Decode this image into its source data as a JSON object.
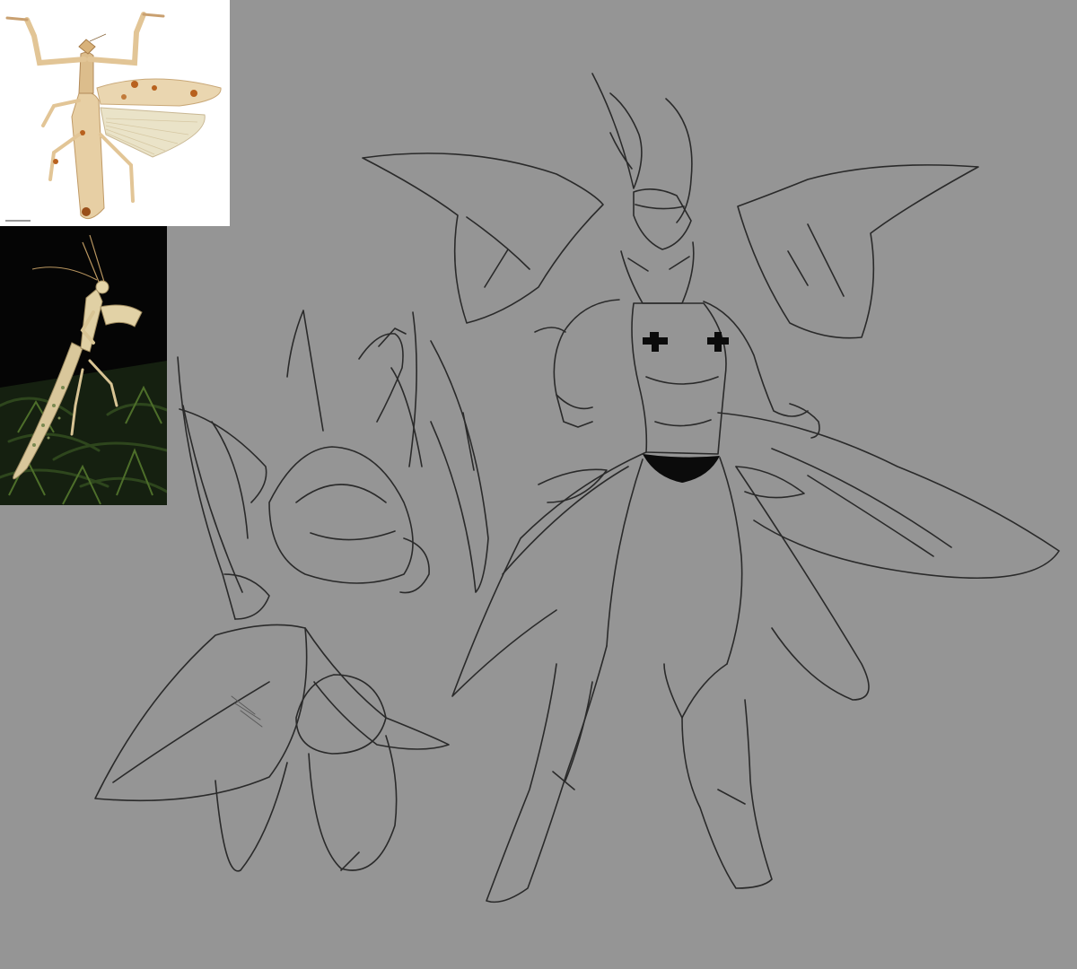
{
  "canvas": {
    "background": "#959595",
    "line_color": "#2a2a2a",
    "light_line_color": "#6b6b6b"
  },
  "reference_photos": [
    {
      "name": "mantis-specimen-photo",
      "background": "#ffffff",
      "body_color": "#e7cfa4",
      "spot_color": "#b8611e",
      "wing_color": "#eae3c8"
    },
    {
      "name": "mantis-live-photo",
      "background": "#050505",
      "foliage_color": "#2f4a1d",
      "body_color": "#d9c79b"
    }
  ],
  "sketches": [
    {
      "name": "mantis-character-back-view-sketch"
    },
    {
      "name": "mantis-character-front-view-sketch"
    }
  ],
  "accents": {
    "clothing_color": "#0b0b0b"
  }
}
